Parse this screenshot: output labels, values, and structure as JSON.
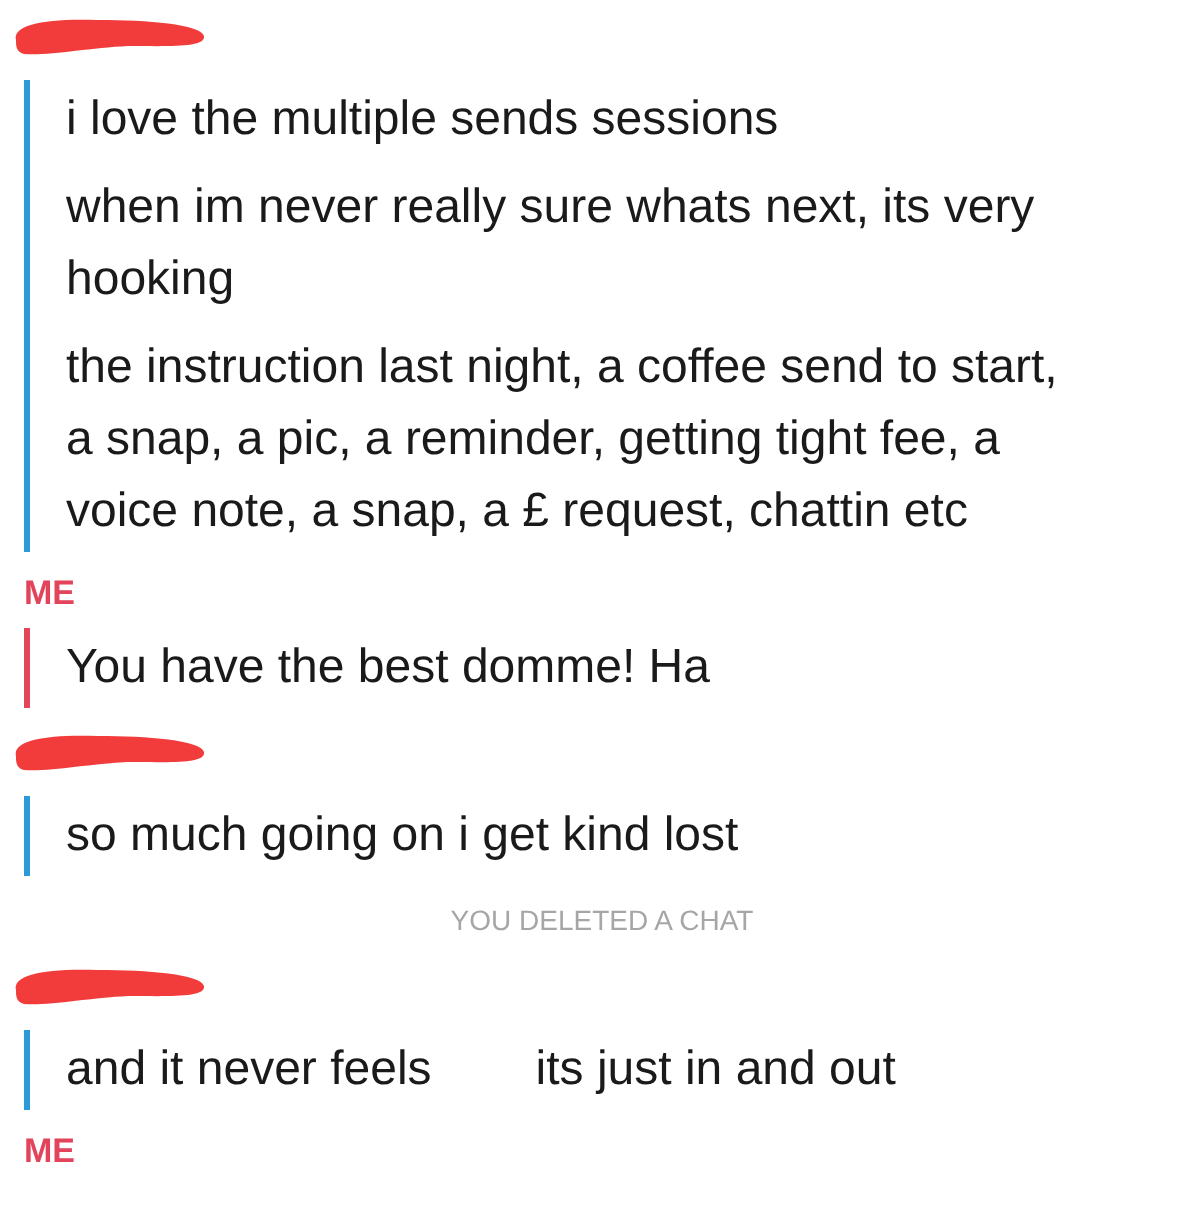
{
  "chat": [
    {
      "kind": "group",
      "sender": {
        "kind": "redacted"
      },
      "color": "#2a9ad8",
      "messages": [
        {
          "parts": [
            "i love the multiple sends sessions"
          ]
        },
        {
          "parts": [
            "when im never really sure whats next, its very hooking"
          ]
        },
        {
          "parts": [
            "the instruction last night, a coffee send to start, a snap, a pic, a reminder, getting tight fee, a voice note, a snap, a £ request, chattin etc"
          ]
        }
      ]
    },
    {
      "kind": "group",
      "sender": {
        "kind": "named",
        "label": "ME"
      },
      "color": "#e2445c",
      "messages": [
        {
          "parts": [
            "You have the best domme! Ha"
          ]
        }
      ]
    },
    {
      "kind": "group",
      "sender": {
        "kind": "redacted"
      },
      "color": "#2a9ad8",
      "messages": [
        {
          "parts": [
            "so much going on i get kind lost"
          ]
        }
      ]
    },
    {
      "kind": "notice",
      "text": "YOU DELETED A CHAT"
    },
    {
      "kind": "group",
      "sender": {
        "kind": "redacted"
      },
      "color": "#2a9ad8",
      "messages": [
        {
          "parts": [
            "and it never feels",
            "its just in and out"
          ]
        }
      ]
    },
    {
      "kind": "label",
      "label": "ME",
      "color": "#e2445c"
    }
  ]
}
